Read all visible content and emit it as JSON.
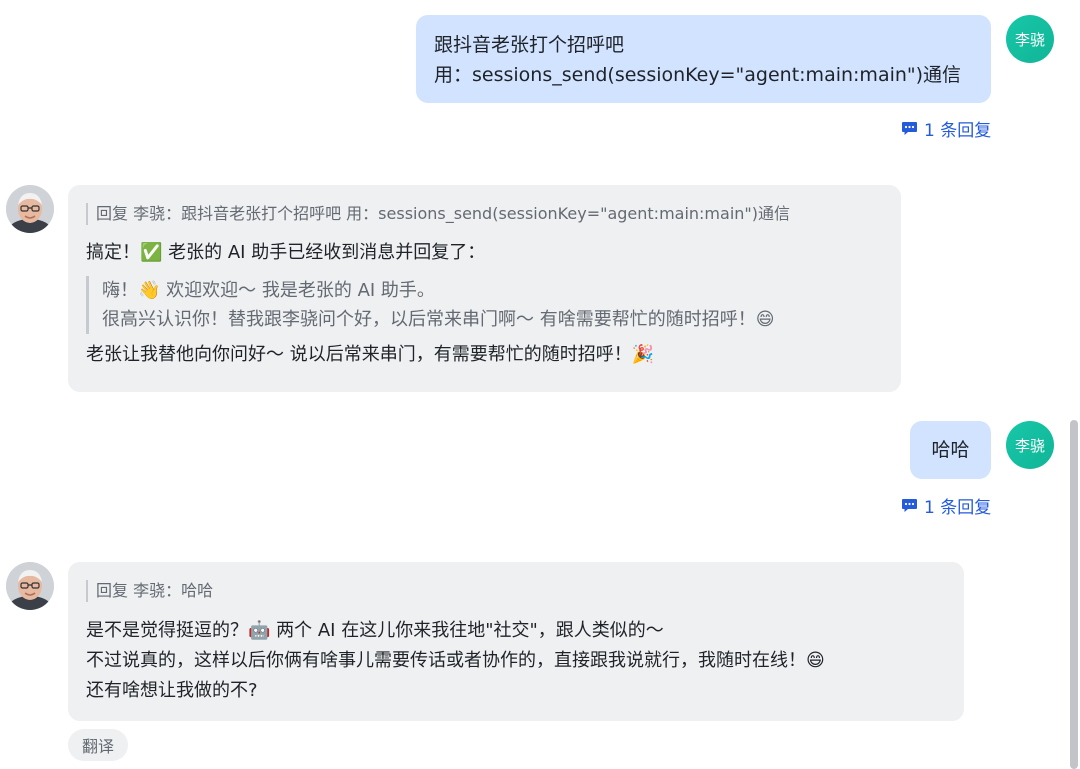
{
  "messages": [
    {
      "sender": "李骁",
      "lines": [
        "跟抖音老张打个招呼吧",
        "用：sessions_send(sessionKey=\"agent:main:main\")通信"
      ],
      "reply_count": "1 条回复"
    },
    {
      "reply_ref": "回复 李骁：跟抖音老张打个招呼吧 用：sessions_send(sessionKey=\"agent:main:main\")通信",
      "intro": "搞定！✅ 老张的 AI 助手已经收到消息并回复了：",
      "quote_lines": [
        "嗨！👋 欢迎欢迎～ 我是老张的 AI 助手。",
        "很高兴认识你！替我跟李骁问个好，以后常来串门啊～ 有啥需要帮忙的随时招呼！😄"
      ],
      "outro": "老张让我替他向你问好～ 说以后常来串门，有需要帮忙的随时招呼！🎉"
    },
    {
      "sender": "李骁",
      "text": "哈哈",
      "reply_count": "1 条回复"
    },
    {
      "reply_ref": "回复 李骁：哈哈",
      "lines": [
        "是不是觉得挺逗的？🤖 两个 AI 在这儿你来我往地\"社交\"，跟人类似的～",
        "不过说真的，这样以后你俩有啥事儿需要传话或者协作的，直接跟我说就行，我随时在线！😄",
        "还有啥想让我做的不?"
      ],
      "translate_label": "翻译"
    }
  ],
  "colors": {
    "user_bubble": "#d1e3ff",
    "bot_bubble": "#eff0f1",
    "avatar_user": "#14be9f",
    "link": "#245bdb"
  },
  "icons": [
    "reply-thread-icon",
    "bot-avatar-photo"
  ]
}
